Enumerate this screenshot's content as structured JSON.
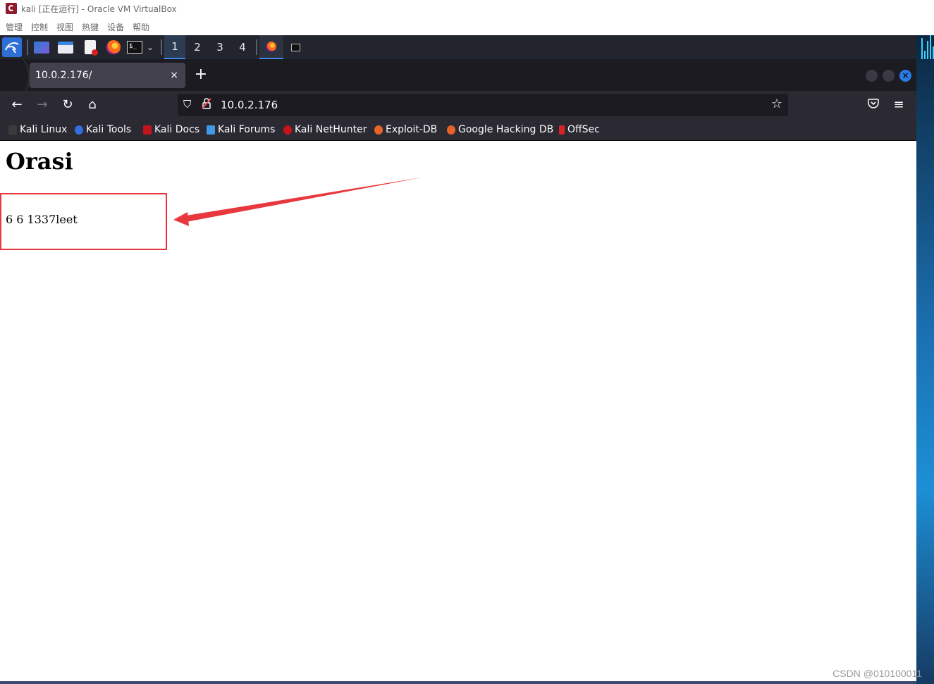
{
  "host_window": {
    "title": "kali [正在运行] - Oracle VM VirtualBox",
    "menu": [
      "管理",
      "控制",
      "视图",
      "热键",
      "设备",
      "帮助"
    ]
  },
  "panel": {
    "workspaces": [
      "1",
      "2",
      "3",
      "4"
    ],
    "active_workspace": "1",
    "launchers": [
      "kali-menu-icon",
      "desktop-icon",
      "file-manager-icon",
      "text-editor-icon",
      "firefox-icon",
      "terminal-icon"
    ]
  },
  "browser": {
    "tab_title": "10.0.2.176/",
    "tab_close": "×",
    "new_tab": "+",
    "url": "10.0.2.176",
    "bookmarks": [
      {
        "label": "Kali Linux",
        "color": "#3b3b3b"
      },
      {
        "label": "Kali Tools",
        "color": "#2f6fe0"
      },
      {
        "label": "Kali Docs",
        "color": "#c4141c"
      },
      {
        "label": "Kali Forums",
        "color": "#3f9ae8"
      },
      {
        "label": "Kali NetHunter",
        "color": "#c4141c"
      },
      {
        "label": "Exploit-DB",
        "color": "#e8632a"
      },
      {
        "label": "Google Hacking DB",
        "color": "#e8632a"
      },
      {
        "label": "OffSec",
        "color": "#d92323"
      }
    ]
  },
  "page": {
    "heading": "Orasi",
    "text": "6 6 1337leet"
  },
  "annotation_color": "#e8383d",
  "watermark": "CSDN @010100011"
}
